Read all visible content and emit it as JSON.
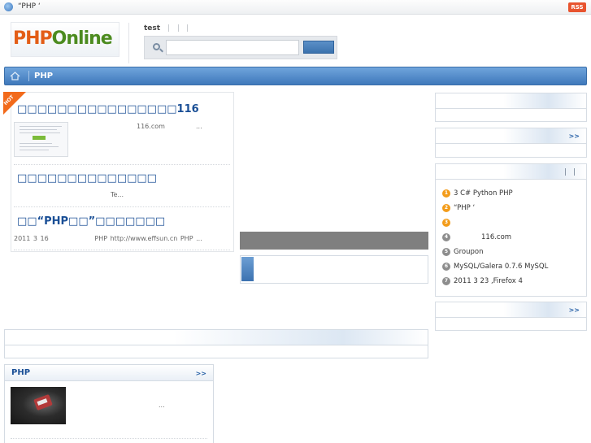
{
  "topbar": {
    "text": "“PHP ‘",
    "rss": "RSS"
  },
  "logo": {
    "php": "PHP",
    "online": "Online"
  },
  "header": {
    "hot_word": "test"
  },
  "nav": {
    "item": "PHP"
  },
  "news": [
    {
      "title": "□□□□□□□□□□□□□□□□116",
      "source": "116.com",
      "more": "..."
    },
    {
      "title": "□□□□□□□□□□□□□□",
      "summary": "Te..."
    },
    {
      "title": "□□“PHP□□”□□□□□□□",
      "date": "2011 3 16",
      "meta": "PHP   http://www.effsun.cn       PHP ..."
    }
  ],
  "right": {
    "more1": ">>",
    "more3": ">>",
    "ranking": [
      {
        "n": "1",
        "text": "3       C# Python PHP",
        "hot": true
      },
      {
        "n": "2",
        "text": "“PHP ‘",
        "hot": true
      },
      {
        "n": "3",
        "text": "",
        "hot": true
      },
      {
        "n": "4",
        "text": "116.com",
        "hot": false
      },
      {
        "n": "5",
        "text": "Groupon",
        "hot": false
      },
      {
        "n": "6",
        "text": "MySQL/Galera 0.7.6   MySQL",
        "hot": false
      },
      {
        "n": "7",
        "text": "2011 3 23 ,Firefox 4",
        "hot": false
      }
    ]
  },
  "php_section": {
    "title": "PHP",
    "more": ">>",
    "ellipsis": "..."
  },
  "colors": {
    "accent": "#3f79bb",
    "headline": "#1a4f96",
    "hot": "#f26a1b"
  }
}
